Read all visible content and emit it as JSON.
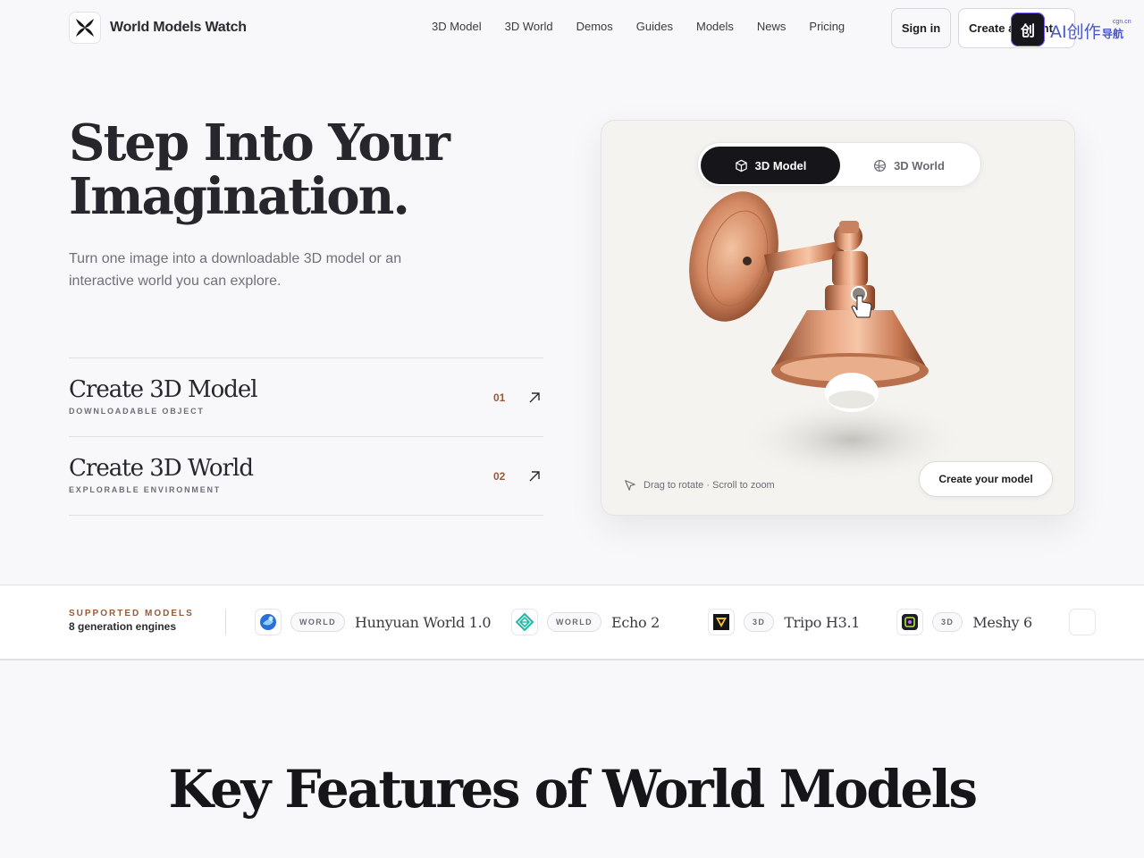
{
  "header": {
    "brand_name": "World Models Watch",
    "nav": [
      "3D Model",
      "3D World",
      "Demos",
      "Guides",
      "Models",
      "News",
      "Pricing"
    ],
    "signin_label": "Sign in",
    "create_account_label": "Create account",
    "watermark": {
      "main": "AI创作",
      "small": "cgn.cn",
      "sub": "导航"
    }
  },
  "hero": {
    "title_line1": "Step Into Your",
    "title_line2": "Imagination.",
    "subtitle": "Turn one image into a downloadable 3D model or an interactive world you can explore.",
    "options": [
      {
        "title": "Create 3D Model",
        "subtitle": "DOWNLOADABLE OBJECT",
        "num": "01"
      },
      {
        "title": "Create 3D World",
        "subtitle": "EXPLORABLE ENVIRONMENT",
        "num": "02"
      }
    ]
  },
  "viewer": {
    "toggle": [
      "3D Model",
      "3D World"
    ],
    "active_toggle": "3D Model",
    "hint": "Drag to rotate · Scroll to zoom",
    "cta": "Create your model"
  },
  "supported": {
    "eyebrow": "SUPPORTED MODELS",
    "count_label": "8 generation engines",
    "models": [
      {
        "tag": "WORLD",
        "name": "Hunyuan World 1.0",
        "logo": "hunyuan-icon"
      },
      {
        "tag": "WORLD",
        "name": "Echo 2",
        "logo": "echo-icon"
      },
      {
        "tag": "3D",
        "name": "Tripo H3.1",
        "logo": "tripo-icon"
      },
      {
        "tag": "3D",
        "name": "Meshy 6",
        "logo": "meshy-icon"
      }
    ]
  },
  "features": {
    "title": "Key Features of World Models"
  },
  "colors": {
    "accent": "#9a5a34",
    "dark": "#16161a",
    "watermark": "#4b57c9"
  }
}
